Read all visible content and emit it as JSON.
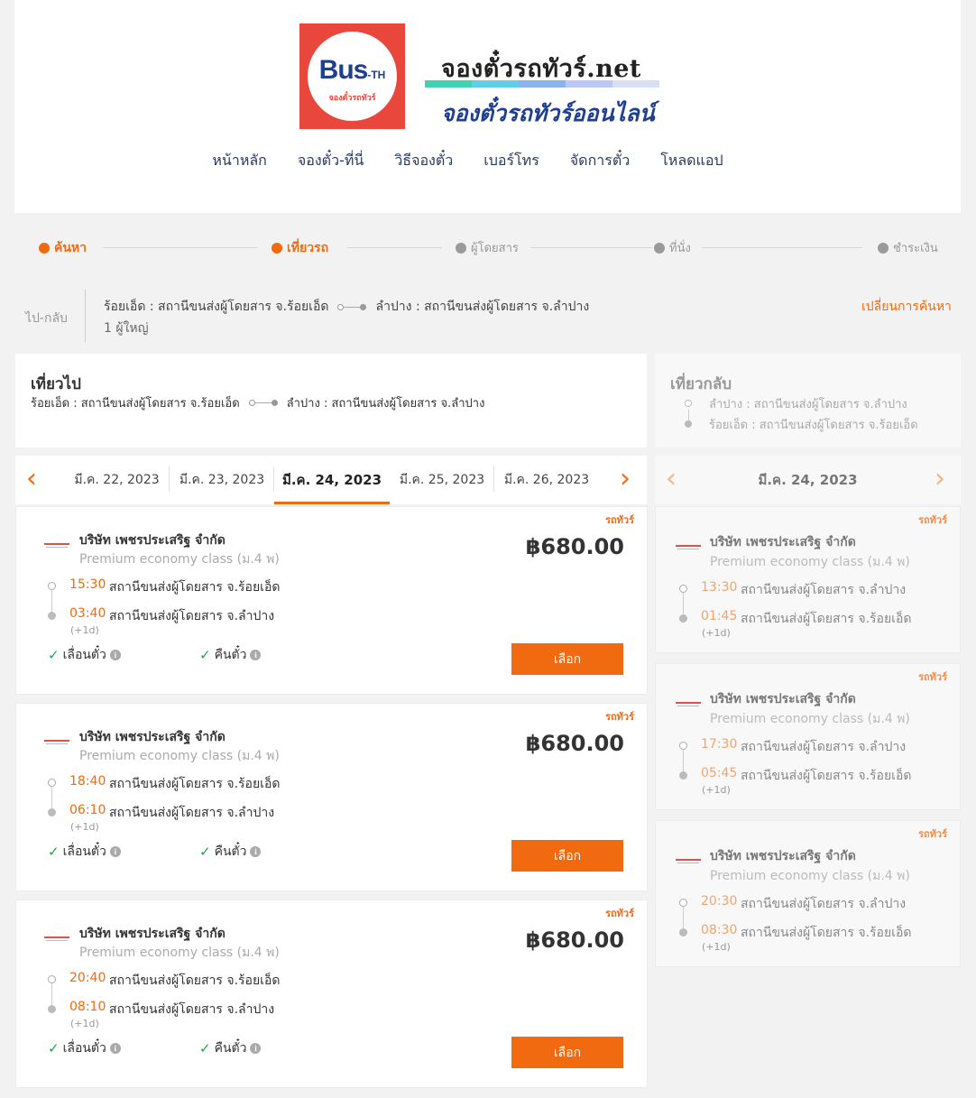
{
  "header": {
    "logo": {
      "bus": "Bus",
      "th": "-TH",
      "sub": "จองตั๋วรถทัวร์"
    },
    "brand_title": "จองตั๋วรถทัวร์.net",
    "brand_sub": "จองตั๋วรถทัวร์ออนไลน์",
    "stripe_colors": [
      "#3ed3b3",
      "#5fd0e8",
      "#8ab4f0",
      "#b9c8f5",
      "#d8dff5"
    ],
    "nav": [
      "หน้าหลัก",
      "จองตั๋ว-ที่นี่",
      "วิธีจองตั๋ว",
      "เบอร์โทร",
      "จัดการตั๋ว",
      "โหลดแอป"
    ]
  },
  "steps": [
    {
      "label": "ค้นหา",
      "active": true
    },
    {
      "label": "เที่ยวรถ",
      "active": true
    },
    {
      "label": "ผู้โดยสาร",
      "active": false
    },
    {
      "label": "ที่นั่ง",
      "active": false
    },
    {
      "label": "ชำระเงิน",
      "active": false
    }
  ],
  "trip": {
    "type": "ไป-กลับ",
    "from": "ร้อยเอ็ด : สถานีขนส่งผู้โดยสาร จ.ร้อยเอ็ด",
    "to": "ลำปาง : สถานีขนส่งผู้โดยสาร จ.ลำปาง",
    "passengers": "1 ผู้ใหญ่",
    "change_label": "เปลี่ยนการค้นหา"
  },
  "outbound": {
    "title": "เที่ยวไป",
    "from": "ร้อยเอ็ด : สถานีขนส่งผู้โดยสาร จ.ร้อยเอ็ด",
    "to": "ลำปาง : สถานีขนส่งผู้โดยสาร จ.ลำปาง",
    "dates": [
      "มี.ค. 22, 2023",
      "มี.ค. 23, 2023",
      "มี.ค. 24, 2023",
      "มี.ค. 25, 2023",
      "มี.ค. 26, 2023"
    ],
    "selected_date_index": 2,
    "trips": [
      {
        "tag": "รถทัวร์",
        "operator": "บริษัท เพชรประเสริฐ จำกัด",
        "class": "Premium economy class (ม.4 พ)",
        "price": "฿680.00",
        "depart_time": "15:30",
        "depart_station": "สถานีขนส่งผู้โดยสาร จ.ร้อยเอ็ด",
        "arrive_time": "03:40",
        "arrive_station": "สถานีขนส่งผู้โดยสาร จ.ลำปาง",
        "next_day": "(+1d)",
        "feature1": "เลื่อนตั๋ว",
        "feature2": "คืนตั๋ว",
        "button": "เลือก"
      },
      {
        "tag": "รถทัวร์",
        "operator": "บริษัท เพชรประเสริฐ จำกัด",
        "class": "Premium economy class (ม.4 พ)",
        "price": "฿680.00",
        "depart_time": "18:40",
        "depart_station": "สถานีขนส่งผู้โดยสาร จ.ร้อยเอ็ด",
        "arrive_time": "06:10",
        "arrive_station": "สถานีขนส่งผู้โดยสาร จ.ลำปาง",
        "next_day": "(+1d)",
        "feature1": "เลื่อนตั๋ว",
        "feature2": "คืนตั๋ว",
        "button": "เลือก"
      },
      {
        "tag": "รถทัวร์",
        "operator": "บริษัท เพชรประเสริฐ จำกัด",
        "class": "Premium economy class (ม.4 พ)",
        "price": "฿680.00",
        "depart_time": "20:40",
        "depart_station": "สถานีขนส่งผู้โดยสาร จ.ร้อยเอ็ด",
        "arrive_time": "08:10",
        "arrive_station": "สถานีขนส่งผู้โดยสาร จ.ลำปาง",
        "next_day": "(+1d)",
        "feature1": "เลื่อนตั๋ว",
        "feature2": "คืนตั๋ว",
        "button": "เลือก"
      }
    ]
  },
  "return": {
    "title": "เที่ยวกลับ",
    "from": "ลำปาง : สถานีขนส่งผู้โดยสาร จ.ลำปาง",
    "to": "ร้อยเอ็ด : สถานีขนส่งผู้โดยสาร จ.ร้อยเอ็ด",
    "date": "มี.ค. 24, 2023",
    "trips": [
      {
        "tag": "รถทัวร์",
        "operator": "บริษัท เพชรประเสริฐ จำกัด",
        "class": "Premium economy class (ม.4 พ)",
        "depart_time": "13:30",
        "depart_station": "สถานีขนส่งผู้โดยสาร จ.ลำปาง",
        "arrive_time": "01:45",
        "arrive_station": "สถานีขนส่งผู้โดยสาร จ.ร้อยเอ็ด",
        "next_day": "(+1d)"
      },
      {
        "tag": "รถทัวร์",
        "operator": "บริษัท เพชรประเสริฐ จำกัด",
        "class": "Premium economy class (ม.4 พ)",
        "depart_time": "17:30",
        "depart_station": "สถานีขนส่งผู้โดยสาร จ.ลำปาง",
        "arrive_time": "05:45",
        "arrive_station": "สถานีขนส่งผู้โดยสาร จ.ร้อยเอ็ด",
        "next_day": "(+1d)"
      },
      {
        "tag": "รถทัวร์",
        "operator": "บริษัท เพชรประเสริฐ จำกัด",
        "class": "Premium economy class (ม.4 พ)",
        "depart_time": "20:30",
        "depart_station": "สถานีขนส่งผู้โดยสาร จ.ลำปาง",
        "arrive_time": "08:30",
        "arrive_station": "สถานีขนส่งผู้โดยสาร จ.ร้อยเอ็ด",
        "next_day": "(+1d)"
      }
    ]
  },
  "colors": {
    "accent": "#f26a0f",
    "logo_red": "#e9473b",
    "logo_blue": "#1f3f8f"
  }
}
